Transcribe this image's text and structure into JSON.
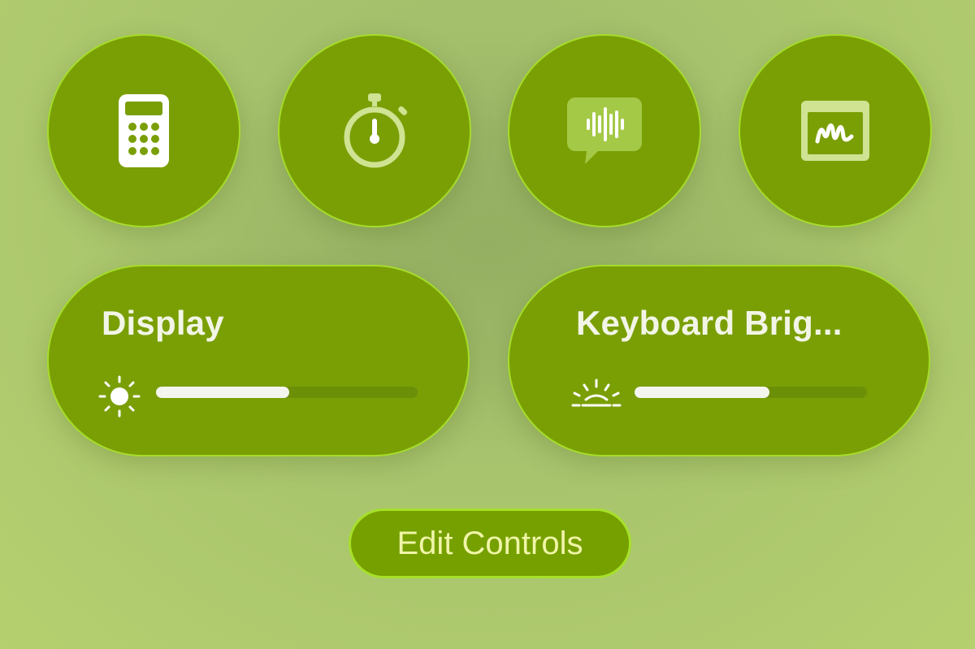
{
  "controls": [
    {
      "icon": "calculator-icon",
      "name": "calculator"
    },
    {
      "icon": "stopwatch-icon",
      "name": "stopwatch"
    },
    {
      "icon": "voice-memo-icon",
      "name": "voice-memos"
    },
    {
      "icon": "freeform-icon",
      "name": "freeform"
    }
  ],
  "display": {
    "title": "Display",
    "icon": "sun-icon",
    "level": 0.51
  },
  "keyboard": {
    "title": "Keyboard Brig...",
    "icon": "keyboard-brightness-icon",
    "level": 0.58
  },
  "edit_controls_label": "Edit Controls",
  "colors": {
    "tile": "#7a9f05",
    "tile_border": "#a6dc2a",
    "background": "#a8c46d",
    "slider_fill": "#f4f5ee",
    "edit_text": "#f0f5a8"
  }
}
